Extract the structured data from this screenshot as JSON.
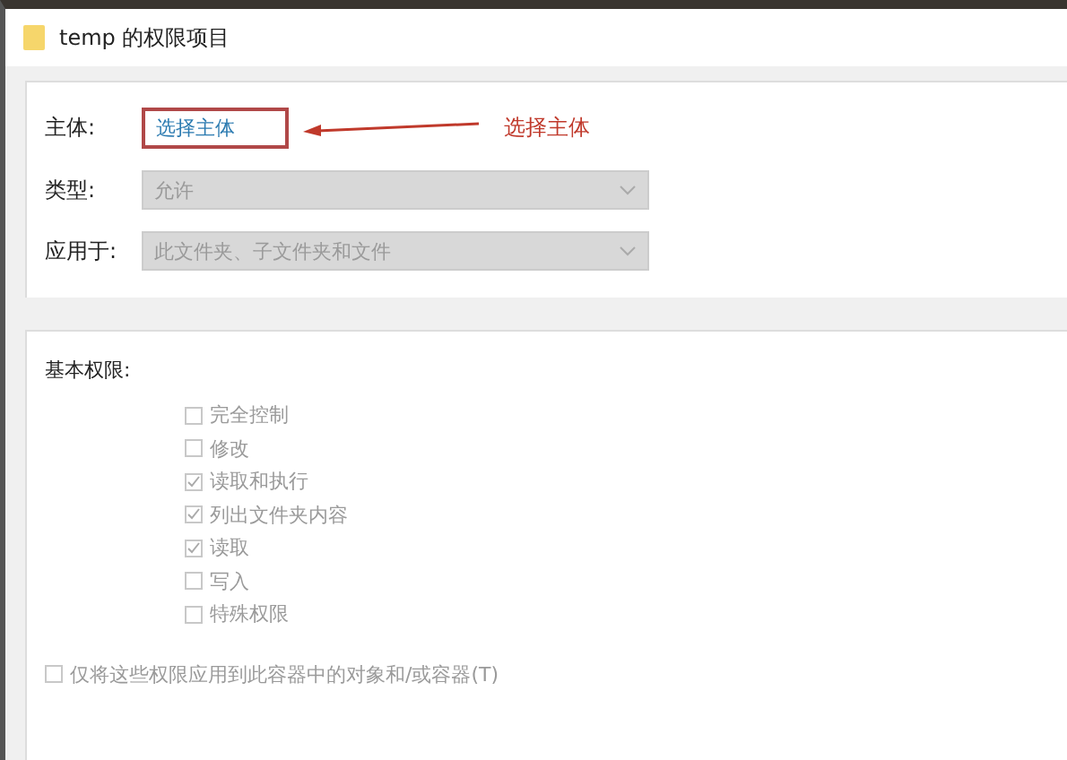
{
  "window": {
    "title": "temp 的权限项目"
  },
  "principal": {
    "label": "主体:",
    "link": "选择主体"
  },
  "annotation": {
    "text": "选择主体"
  },
  "fields": [
    {
      "label": "类型:",
      "value": "允许",
      "disabled": true
    },
    {
      "label": "应用于:",
      "value": "此文件夹、子文件夹和文件",
      "disabled": true
    }
  ],
  "permissions": {
    "heading": "基本权限:",
    "items": [
      {
        "label": "完全控制",
        "checked": false,
        "disabled": true
      },
      {
        "label": "修改",
        "checked": false,
        "disabled": true
      },
      {
        "label": "读取和执行",
        "checked": true,
        "disabled": true
      },
      {
        "label": "列出文件夹内容",
        "checked": true,
        "disabled": true
      },
      {
        "label": "读取",
        "checked": true,
        "disabled": true
      },
      {
        "label": "写入",
        "checked": false,
        "disabled": true
      },
      {
        "label": "特殊权限",
        "checked": false,
        "disabled": true
      }
    ]
  },
  "apply_only": {
    "label": "仅将这些权限应用到此容器中的对象和/或容器(T)",
    "checked": false,
    "disabled": true
  }
}
